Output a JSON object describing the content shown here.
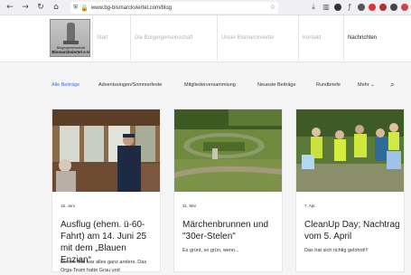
{
  "browser": {
    "back": "←",
    "forward": "→",
    "reload": "↻",
    "home": "⌂",
    "url": "www.bg-bismarckviertel.com/blog",
    "icons": [
      "download-icon",
      "library-icon",
      "account-icon",
      "extensions-icon"
    ]
  },
  "site": {
    "logo": {
      "line1": "Bürgergemeinschaft",
      "line2": "Bismarckviertel e.V."
    },
    "menu": [
      {
        "label": "Start",
        "active": false
      },
      {
        "label": "Die Bürgergemeinschaft",
        "active": false
      },
      {
        "label": "Unser Bismarckviertel",
        "active": false
      },
      {
        "label": "Kontakt",
        "active": false
      },
      {
        "label": "Nachrichten",
        "active": true
      }
    ]
  },
  "filters": {
    "all": "Alle Beiträge",
    "advent": "Adventssingen/Sommerfeste",
    "meeting": "Mitgliederversammlung",
    "news": "Neueste Beiträge",
    "letters": "Rundbriefe",
    "more": "Mehr",
    "more_arrow": "⌄"
  },
  "posts": [
    {
      "date": "15. Juni",
      "title": "Ausflug (ehem. ü-60-Fahrt) am 14. Juni 25 mit dem „Blauen Enzian“",
      "excerpt": "Dieses Mal war alles ganz anders. Das Orga-Team hatte Grau und"
    },
    {
      "date": "31. Mai",
      "title": "Märchenbrunnen und \"30er-Stelen\"",
      "excerpt": "Es grünt, so grün, wenn..."
    },
    {
      "date": "7. Apr.",
      "title": "CleanUp Day; Nachtrag vom 5. April",
      "excerpt": "Das hat sich richtig gelohnt!!!"
    }
  ],
  "colors": {
    "accent": "#3f6bdc",
    "inactive_menu": "#b5b5b5"
  }
}
